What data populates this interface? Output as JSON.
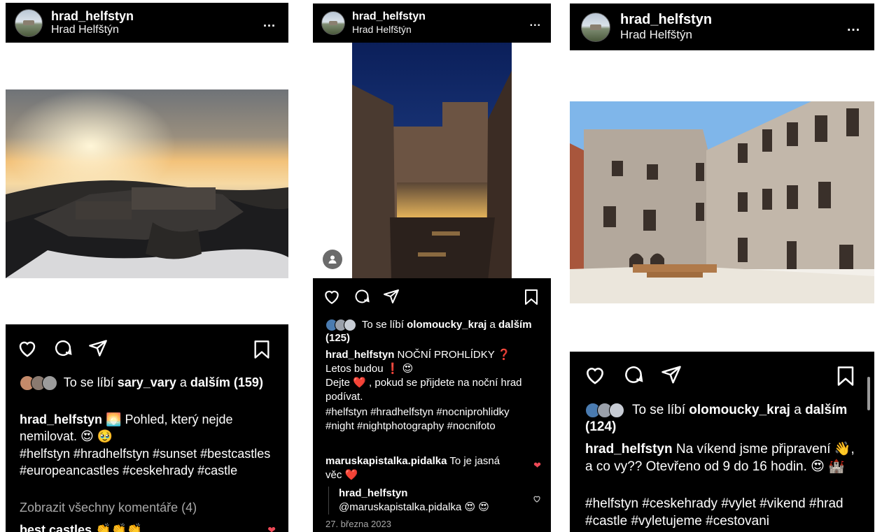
{
  "posts": [
    {
      "username": "hrad_helfstyn",
      "location": "Hrad Helfštýn",
      "more": "...",
      "likes_prefix": "To se líbí",
      "likes_user": "sary_vary",
      "likes_and": "a",
      "likes_rest": "dalším (159)",
      "caption_user": "hrad_helfstyn",
      "caption_text": "🌅 Pohled, který nejde nemilovat. 😍 🥹",
      "hashtags": "#helfstyn #hradhelfstyn #sunset #bestcastles #europeancastles #ceskehrady #castle",
      "view_comments": "Zobrazit všechny komentáře (4)",
      "comment_user": "best.castles",
      "comment_text": "👏👏👏"
    },
    {
      "username": "hrad_helfstyn",
      "location": "Hrad Helfštýn",
      "more": "...",
      "likes_prefix": "To se líbí",
      "likes_user": "olomoucky_kraj",
      "likes_and": "a",
      "likes_rest": "dalším (125)",
      "caption_user": "hrad_helfstyn",
      "caption_text_1": "NOČNÍ PROHLÍDKY ❓ Letos budou ❗ 😍",
      "caption_text_2": "Dejte ❤️ , pokud se přijdete na noční hrad podívat.",
      "hashtags": "#helfstyn #hradhelfstyn #nocniprohlidky #night #nightphotography #nocnifoto",
      "comment_user": "maruskapistalka.pidalka",
      "comment_text": "To je jasná věc ❤️",
      "reply_user": "hrad_helfstyn",
      "reply_text": "@maruskapistalka.pidalka 😍 😍",
      "date": "27. března 2023"
    },
    {
      "username": "hrad_helfstyn",
      "location": "Hrad Helfštýn",
      "more": "...",
      "likes_prefix": "To se líbí",
      "likes_user": "olomoucky_kraj",
      "likes_and": "a",
      "likes_rest": "dalším (124)",
      "caption_user": "hrad_helfstyn",
      "caption_text": "Na víkend jsme připravení 👋, a co vy?? Otevřeno od 9 do 16 hodin. 😍 🏰",
      "hashtags": "#helfstyn #ceskehrady #vylet #vikend #hrad #castle #vyletujeme #cestovani"
    }
  ],
  "icons": {
    "like": "heart-outline",
    "comment": "speech-bubble",
    "share": "paper-plane",
    "save": "bookmark",
    "tagged": "person-tag",
    "liked_comment": "heart-filled",
    "unliked_reply": "heart-outline"
  },
  "colors": {
    "panel": "#000000",
    "text": "#ffffff",
    "muted": "#a8a8a8",
    "red_heart": "#ed4956"
  }
}
